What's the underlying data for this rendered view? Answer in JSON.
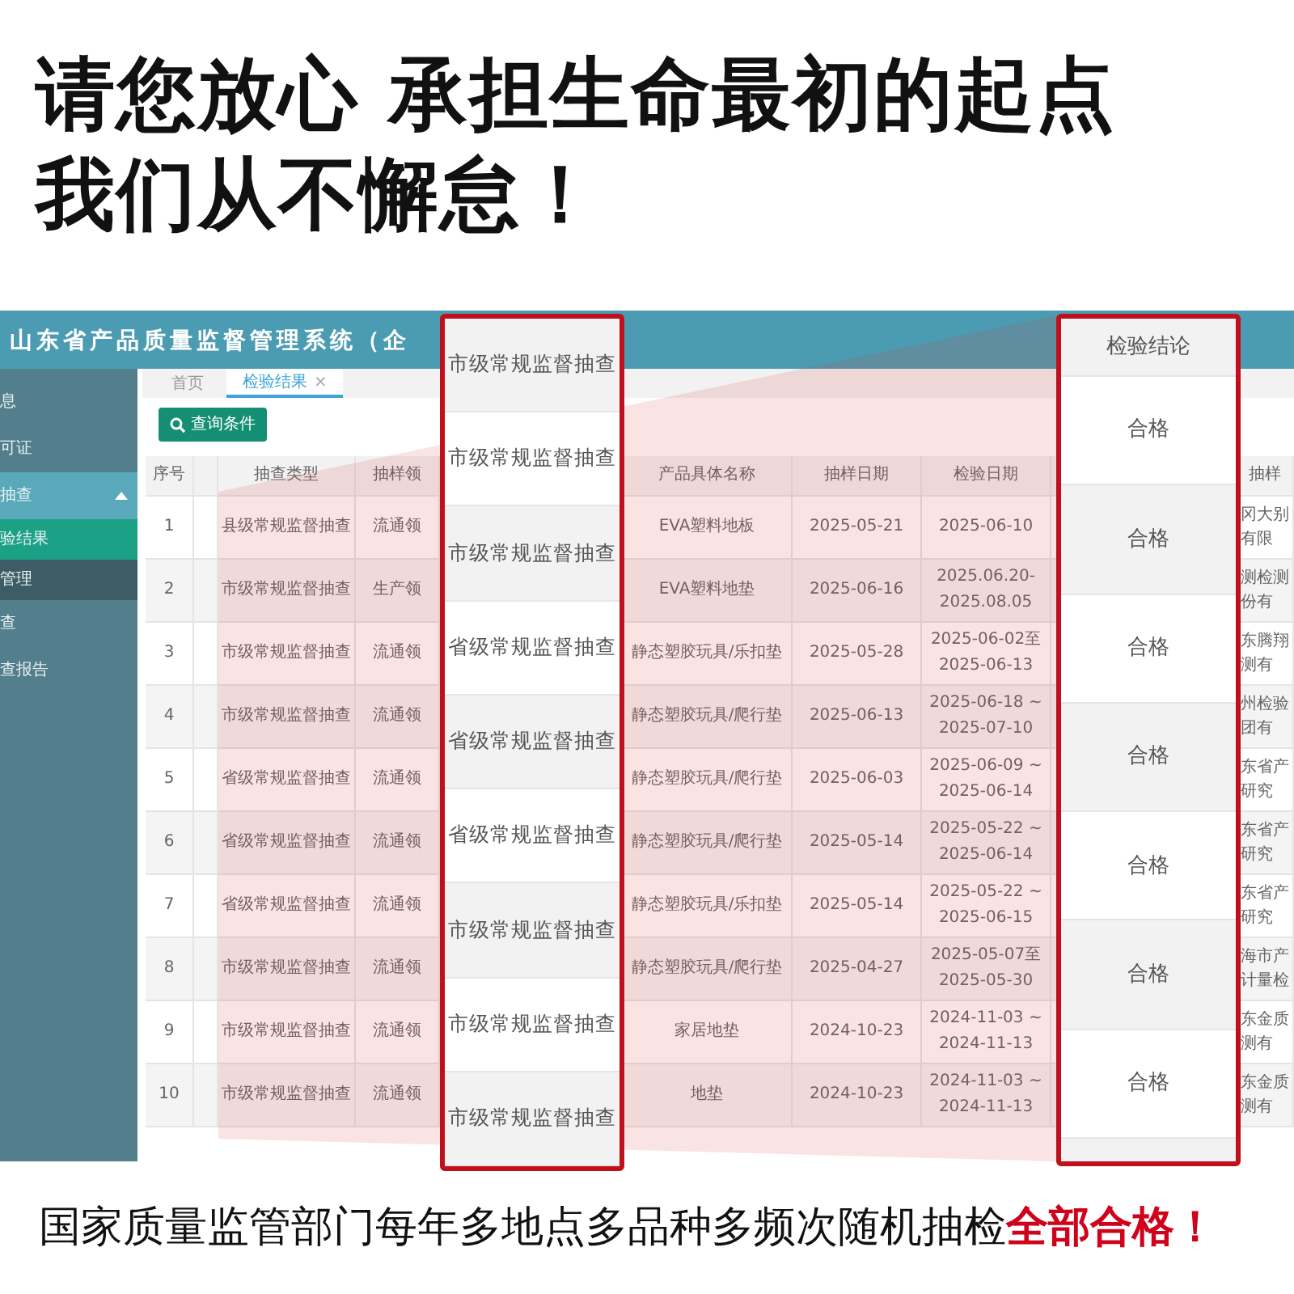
{
  "headline": [
    "请您放心 承担生命最初的起点",
    "我们从不懈怠！"
  ],
  "app": {
    "title": "山东省产品质量监督管理系统（企",
    "sidebar": [
      {
        "label": "息",
        "kind": "item",
        "selected": false
      },
      {
        "label": "可证",
        "kind": "item",
        "selected": false
      },
      {
        "label": "抽查",
        "kind": "group",
        "selected": false,
        "expanded": true
      },
      {
        "label": "验结果",
        "kind": "subitem",
        "selected": true
      },
      {
        "label": "管理",
        "kind": "subitem",
        "selected": false
      },
      {
        "label": "查",
        "kind": "item",
        "selected": false
      },
      {
        "label": "查报告",
        "kind": "item",
        "selected": false
      }
    ],
    "tabs": [
      {
        "label": "首页",
        "selected": false
      },
      {
        "label": "检验结果",
        "selected": true,
        "close": "×"
      }
    ],
    "query_button": "查询条件",
    "table": {
      "columns": [
        "序号",
        "抽查类型",
        "抽样领",
        "产品具体名称",
        "抽样日期",
        "检验日期",
        "抽样"
      ],
      "rows": [
        {
          "no": "1",
          "type": "县级常规监督抽查",
          "field": "流通领",
          "product": "EVA塑料地板",
          "sample_date": "2025-05-21",
          "test_date": "2025-06-10",
          "lab": [
            "冈大别",
            "有限"
          ]
        },
        {
          "no": "2",
          "type": "市级常规监督抽查",
          "field": "生产领",
          "product": "EVA塑料地垫",
          "sample_date": "2025-06-16",
          "test_date": "2025.06.20-\n2025.08.05",
          "lab": [
            "测检测",
            "份有"
          ]
        },
        {
          "no": "3",
          "type": "市级常规监督抽查",
          "field": "流通领",
          "product": "静态塑胶玩具/乐扣垫",
          "sample_date": "2025-05-28",
          "test_date": "2025-06-02至\n2025-06-13",
          "lab": [
            "东腾翔",
            "测有"
          ]
        },
        {
          "no": "4",
          "type": "市级常规监督抽查",
          "field": "流通领",
          "product": "静态塑胶玩具/爬行垫",
          "sample_date": "2025-06-13",
          "test_date": "2025-06-18 ~\n2025-07-10",
          "lab": [
            "州检验",
            "团有"
          ]
        },
        {
          "no": "5",
          "type": "省级常规监督抽查",
          "field": "流通领",
          "product": "静态塑胶玩具/爬行垫",
          "sample_date": "2025-06-03",
          "test_date": "2025-06-09 ~\n2025-06-14",
          "lab": [
            "东省产",
            "研究"
          ]
        },
        {
          "no": "6",
          "type": "省级常规监督抽查",
          "field": "流通领",
          "product": "静态塑胶玩具/爬行垫",
          "sample_date": "2025-05-14",
          "test_date": "2025-05-22 ~\n2025-06-14",
          "lab": [
            "东省产",
            "研究"
          ]
        },
        {
          "no": "7",
          "type": "省级常规监督抽查",
          "field": "流通领",
          "product": "静态塑胶玩具/乐扣垫",
          "sample_date": "2025-05-14",
          "test_date": "2025-05-22 ~\n2025-06-15",
          "lab": [
            "东省产",
            "研究"
          ]
        },
        {
          "no": "8",
          "type": "市级常规监督抽查",
          "field": "流通领",
          "product": "静态塑胶玩具/爬行垫",
          "sample_date": "2025-04-27",
          "test_date": "2025-05-07至\n2025-05-30",
          "lab": [
            "海市产",
            "计量检"
          ]
        },
        {
          "no": "9",
          "type": "市级常规监督抽查",
          "field": "流通领",
          "product": "家居地垫",
          "sample_date": "2024-10-23",
          "test_date": "2024-11-03 ~\n2024-11-13",
          "lab": [
            "东金质",
            "测有"
          ]
        },
        {
          "no": "10",
          "type": "市级常规监督抽查",
          "field": "流通领",
          "product": "地垫",
          "sample_date": "2024-10-23",
          "test_date": "2024-11-03 ~\n2024-11-13",
          "lab": [
            "东金质",
            "测有"
          ]
        }
      ]
    }
  },
  "callouts": {
    "left": {
      "cells": [
        "市级常规监督抽查",
        "市级常规监督抽查",
        "市级常规监督抽查",
        "省级常规监督抽查",
        "省级常规监督抽查",
        "省级常规监督抽查",
        "市级常规监督抽查",
        "市级常规监督抽查",
        "市级常规监督抽查"
      ]
    },
    "right": {
      "header": "检验结论",
      "cells": [
        "合格",
        "合格",
        "合格",
        "合格",
        "合格",
        "合格",
        "合格"
      ]
    }
  },
  "caption": "国家质量监管部门每年多地点多品种多频次随机抽检**全部合格！**"
}
